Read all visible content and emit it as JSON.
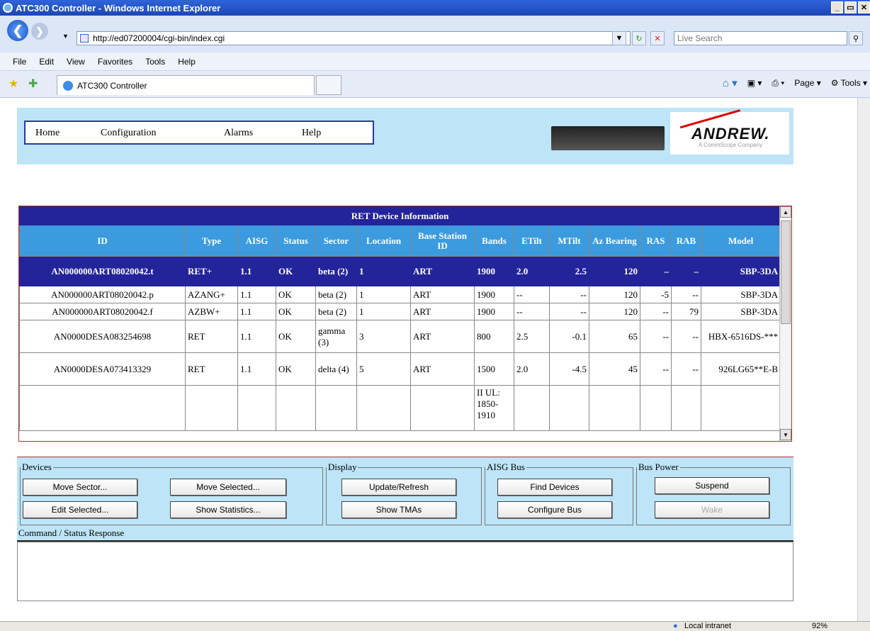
{
  "browser": {
    "window_title": "ATC300 Controller - Windows Internet Explorer",
    "address": "http://ed07200004/cgi-bin/index.cgi",
    "search_placeholder": "Live Search",
    "menu": [
      "File",
      "Edit",
      "View",
      "Favorites",
      "Tools",
      "Help"
    ],
    "tab_title": "ATC300 Controller",
    "commands": [
      "Page",
      "Tools"
    ],
    "status_zone": "Local intranet",
    "zoom": "92%"
  },
  "nav": {
    "items": [
      "Home",
      "Configuration",
      "Alarms",
      "Help"
    ]
  },
  "logo": {
    "brand": "ANDREW.",
    "tagline": "A CommScope Company"
  },
  "table": {
    "caption": "RET Device Information",
    "headers": [
      "ID",
      "Type",
      "AISG",
      "Status",
      "Sector",
      "Location",
      "Base Station ID",
      "Bands",
      "ETilt",
      "MTilt",
      "Az Bearing",
      "RAS",
      "RAB",
      "Model"
    ],
    "rows": [
      [
        "AN000000ART08020042.t",
        "RET+",
        "1.1",
        "OK",
        "beta (2)",
        "1",
        "ART",
        "1900",
        "2.0",
        "2.5",
        "120",
        "–",
        "–",
        "SBP-3DA"
      ],
      [
        "AN000000ART08020042.p",
        "AZANG+",
        "1.1",
        "OK",
        "beta (2)",
        "1",
        "ART",
        "1900",
        "--",
        "--",
        "120",
        "-5",
        "--",
        "SBP-3DA"
      ],
      [
        "AN000000ART08020042.f",
        "AZBW+",
        "1.1",
        "OK",
        "beta (2)",
        "1",
        "ART",
        "1900",
        "--",
        "--",
        "120",
        "--",
        "79",
        "SBP-3DA"
      ],
      [
        "AN0000DESA083254698",
        "RET",
        "1.1",
        "OK",
        "gamma (3)",
        "3",
        "ART",
        "800",
        "2.5",
        "-0.1",
        "65",
        "--",
        "--",
        "HBX-6516DS-***"
      ],
      [
        "AN0000DESA073413329",
        "RET",
        "1.1",
        "OK",
        "delta (4)",
        "5",
        "ART",
        "1500",
        "2.0",
        "-4.5",
        "45",
        "--",
        "--",
        "926LG65**E-B"
      ],
      [
        "",
        "",
        "",
        "",
        "",
        "",
        "",
        "II UL: 1850-1910",
        "",
        "",
        "",
        "",
        "",
        ""
      ]
    ]
  },
  "panel": {
    "devices_legend": "Devices",
    "display_legend": "Display",
    "aisg_legend": "AISG Bus",
    "power_legend": "Bus Power",
    "buttons": {
      "move_sector": "Move Sector...",
      "move_selected": "Move Selected...",
      "edit_selected": "Edit Selected...",
      "show_statistics": "Show Statistics...",
      "update_refresh": "Update/Refresh",
      "show_tmas": "Show TMAs",
      "find_devices": "Find Devices",
      "configure_bus": "Configure Bus",
      "suspend": "Suspend",
      "wake": "Wake"
    }
  },
  "response": {
    "label": "Command / Status Response",
    "text": ""
  }
}
